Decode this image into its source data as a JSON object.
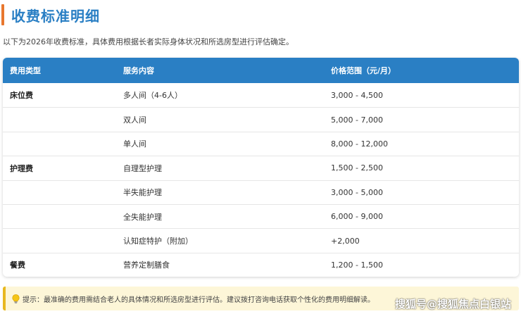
{
  "section": {
    "title": "收费标准明细",
    "intro": "以下为2026年收费标准，具体费用根据长者实际身体状况和所选房型进行评估确定。"
  },
  "table": {
    "headers": [
      "费用类型",
      "服务内容",
      "价格范围（元/月）"
    ],
    "rows": [
      {
        "category": "床位费",
        "service": "多人间（4-6人）",
        "price": "3,000 - 4,500"
      },
      {
        "category": "",
        "service": "双人间",
        "price": "5,000 - 7,000"
      },
      {
        "category": "",
        "service": "单人间",
        "price": "8,000 - 12,000"
      },
      {
        "category": "护理费",
        "service": "自理型护理",
        "price": "1,500 - 2,500"
      },
      {
        "category": "",
        "service": "半失能护理",
        "price": "3,000 - 5,000"
      },
      {
        "category": "",
        "service": "全失能护理",
        "price": "6,000 - 9,000"
      },
      {
        "category": "",
        "service": "认知症特护（附加）",
        "price": "+2,000"
      },
      {
        "category": "餐费",
        "service": "营养定制膳食",
        "price": "1,200 - 1,500"
      }
    ]
  },
  "tip": {
    "icon": "lightbulb-icon",
    "text": "提示：最准确的费用需结合老人的具体情况和所选房型进行评估。建议拨打咨询电话获取个性化的费用明细解读。"
  },
  "watermark": "搜狐号@搜狐焦点白银站",
  "colors": {
    "accent": "#2a7fc4",
    "title_bar": "#e8772e",
    "tip_bg": "#fdf6d8",
    "tip_border": "#e8b820"
  }
}
